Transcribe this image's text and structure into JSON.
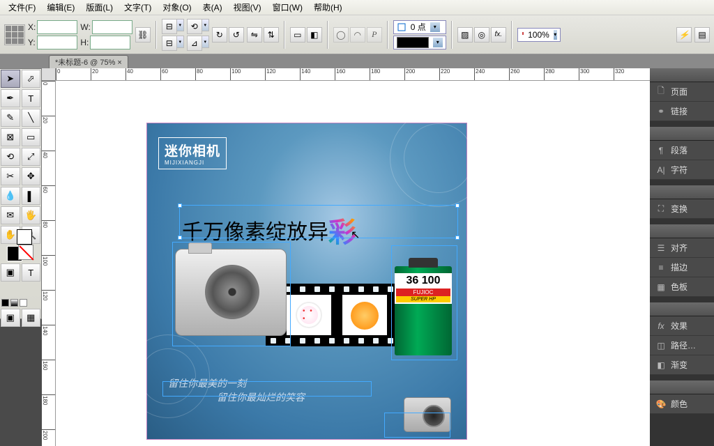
{
  "menu": {
    "file": "文件(F)",
    "edit": "编辑(E)",
    "layout": "版面(L)",
    "text": "文字(T)",
    "object": "对象(O)",
    "table": "表(A)",
    "view": "视图(V)",
    "window": "窗口(W)",
    "help": "帮助(H)"
  },
  "control": {
    "x_label": "X:",
    "y_label": "Y:",
    "w_label": "W:",
    "h_label": "H:",
    "stroke_label": "0 点",
    "zoom": "100%"
  },
  "tab": {
    "title": "*未标题-6 @ 75% ×"
  },
  "ruler": {
    "h": [
      "0",
      "20",
      "40",
      "60",
      "80",
      "100",
      "120",
      "140",
      "160",
      "180",
      "200",
      "220",
      "240",
      "260",
      "280",
      "300",
      "320"
    ],
    "v": [
      "0",
      "20",
      "40",
      "60",
      "80",
      "100",
      "120",
      "140",
      "160",
      "180",
      "200"
    ]
  },
  "ad": {
    "brand_cn": "迷你相机",
    "brand_en": "MIJIXIANGJI",
    "headline_main": "千万像素绽放异",
    "headline_cai": "彩",
    "film_num": "36 100",
    "film_brand": "FUJIOC",
    "film_super": "SUPER HP",
    "tagline1": "留住你最美的一刻",
    "tagline2": "留住你最灿烂的笑容"
  },
  "panels": {
    "page": "页面",
    "link": "链接",
    "para": "段落",
    "char": "字符",
    "transform": "变换",
    "align": "对齐",
    "stroke": "描边",
    "swatch": "色板",
    "effect": "效果",
    "path": "路径…",
    "gradient": "渐变",
    "color": "颜色"
  }
}
